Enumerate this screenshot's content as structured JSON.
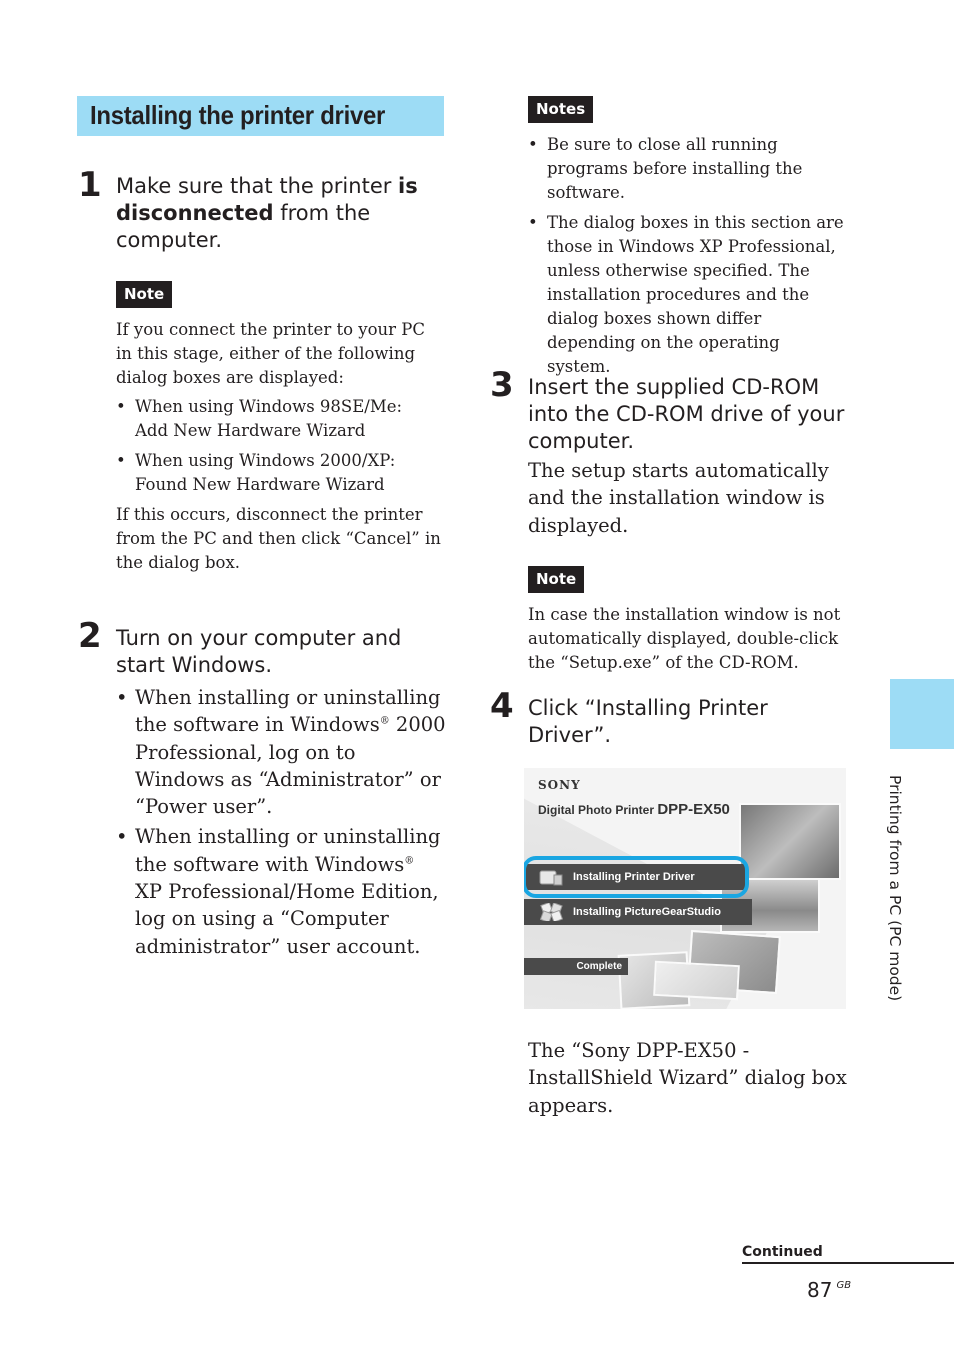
{
  "section_title": "Installing the printer driver",
  "left_column": {
    "step1": {
      "number": "1",
      "heading_pre": "Make sure that the printer ",
      "heading_bold": "is disconnected",
      "heading_post": " from the computer.",
      "note_label": "Note",
      "note_intro": "If you connect the printer to your PC in this stage, either of the following dialog boxes are displayed:",
      "note_bullets": [
        "When using Windows 98SE/Me: Add New Hardware Wizard",
        "When using Windows 2000/XP: Found New Hardware Wizard"
      ],
      "note_outro": "If this occurs, disconnect the printer from the PC and then click “Cancel” in the dialog box."
    },
    "step2": {
      "number": "2",
      "heading": "Turn on your computer and start Windows.",
      "bullets": [
        {
          "pre": "When installing or uninstalling the software in Windows",
          "reg": "®",
          "post": " 2000 Professional, log on to Windows as “Administrator” or “Power user”."
        },
        {
          "pre": "When installing or uninstalling the software with Windows",
          "reg": "®",
          "post": " XP Professional/Home Edition, log on using a “Computer administrator” user account."
        }
      ]
    }
  },
  "right_column": {
    "notes_label": "Notes",
    "notes_bullets": [
      "Be sure to close all running programs before installing the software.",
      "The dialog boxes in this section are those in Windows XP Professional, unless otherwise specified.  The installation procedures and the dialog boxes shown differ depending on the operating system."
    ],
    "step3": {
      "number": "3",
      "heading": "Insert the supplied CD-ROM into the CD-ROM drive of your computer.",
      "body": "The setup starts automatically and the installation window is displayed.",
      "note_label": "Note",
      "note_text": "In case the installation window is not automatically displayed, double-click the “Setup.exe” of the CD-ROM."
    },
    "step4": {
      "number": "4",
      "heading": "Click “Installing Printer Driver”.",
      "screenshot": {
        "brand": "SONY",
        "product": "Digital Photo Printer ",
        "model": "DPP-EX50",
        "buttons": [
          {
            "label": "Installing Printer Driver",
            "icon": "printer-icon",
            "highlighted": true
          },
          {
            "label": "Installing PictureGearStudio",
            "icon": "photos-icon",
            "highlighted": false
          },
          {
            "label": "Complete",
            "icon": "",
            "highlighted": false
          }
        ],
        "highlight_color": "#1aa6e2"
      },
      "result_text": "The “Sony DPP-EX50 - InstallShield Wizard” dialog box appears."
    }
  },
  "side_tab": {
    "label": "Printing from a PC (PC mode)",
    "color": "#9ddcf5"
  },
  "footer": {
    "continued": "Continued",
    "page_number": "87",
    "region": "GB"
  }
}
